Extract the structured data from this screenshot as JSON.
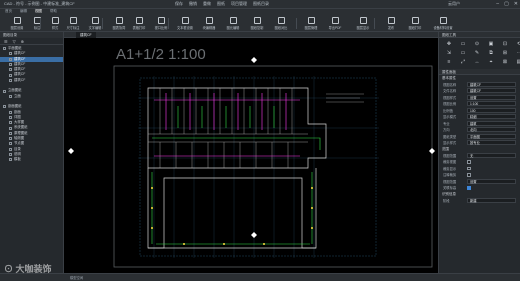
{
  "titlebar": {
    "title": "CAD - 符号 - 示例图 - 中建标准_建筑CF"
  },
  "quick_actions": [
    "保存",
    "撤销",
    "重做",
    "图纸",
    "项目管理",
    "图纸目录"
  ],
  "user": {
    "name": "云用户"
  },
  "menu_tabs": [
    "首页",
    "编辑",
    "视图",
    "帮助"
  ],
  "ribbon_buttons": [
    "图层设置",
    "标注",
    "样式",
    "尺寸标注",
    "文字编辑",
    "图表协同",
    "表格打印",
    "视口比例",
    "文本框设置",
    "块编辑器",
    "图元编辑",
    "图纸复制",
    "图纸对比",
    "图层管理",
    "导出PDF",
    "图层显示",
    "发布",
    "图纸打印",
    "设备材料设置"
  ],
  "left_panel": {
    "header": "图纸目录",
    "tools": [
      "☰",
      "▽",
      "⊕"
    ],
    "items": [
      {
        "label": "平面图纸",
        "indent": 0,
        "selected": false
      },
      {
        "label": "建筑CF",
        "indent": 1,
        "selected": false
      },
      {
        "label": "建筑CF",
        "indent": 1,
        "selected": true
      },
      {
        "label": "建筑CF",
        "indent": 1,
        "selected": false
      },
      {
        "label": "建筑CF",
        "indent": 1,
        "selected": false
      },
      {
        "label": "建筑CF",
        "indent": 1,
        "selected": false
      },
      {
        "label": "建筑CF",
        "indent": 1,
        "selected": false
      },
      {
        "label": "",
        "indent": 0,
        "selected": false
      },
      {
        "label": "立面图纸",
        "indent": 0,
        "selected": false
      },
      {
        "label": "立面",
        "indent": 1,
        "selected": false
      },
      {
        "label": "",
        "indent": 0,
        "selected": false
      },
      {
        "label": "剖面图纸",
        "indent": 0,
        "selected": false
      },
      {
        "label": "剖面",
        "indent": 1,
        "selected": false
      },
      {
        "label": "详图",
        "indent": 1,
        "selected": false
      },
      {
        "label": "大样图",
        "indent": 1,
        "selected": false
      },
      {
        "label": "系统图纸",
        "indent": 1,
        "selected": false
      },
      {
        "label": "原理图纸",
        "indent": 1,
        "selected": false
      },
      {
        "label": "轴测图",
        "indent": 1,
        "selected": false
      },
      {
        "label": "节点图",
        "indent": 1,
        "selected": false
      },
      {
        "label": "目录",
        "indent": 1,
        "selected": false
      },
      {
        "label": "说明",
        "indent": 1,
        "selected": false
      },
      {
        "label": "模板",
        "indent": 1,
        "selected": false
      }
    ]
  },
  "doc_tab": {
    "label": "建筑CF"
  },
  "canvas": {
    "sheet_title": "A1+1/2 1:100"
  },
  "right_panel": {
    "section1": "图纸工具",
    "tools": [
      "✥",
      "▭",
      "⊙",
      "▣",
      "⊡",
      "⟲",
      "⇲",
      "▭",
      "✎",
      "⧉",
      "⊞",
      "⋯",
      "≡",
      "⤢",
      "↔",
      "⌖",
      "⊠",
      "▤"
    ],
    "section2": "属性面板",
    "section3": "基本属性",
    "props": [
      {
        "k": "视图名称",
        "v": "建筑CF"
      },
      {
        "k": "文件名称",
        "v": "建筑CF"
      },
      {
        "k": "视图样式",
        "v": "设置"
      },
      {
        "k": "视图比例",
        "v": "1:100"
      },
      {
        "k": "比例值",
        "v": "100"
      },
      {
        "k": "显示模式",
        "v": "精细"
      },
      {
        "k": "专业",
        "v": "建筑"
      },
      {
        "k": "方向",
        "v": "北向"
      },
      {
        "k": "图纸类型",
        "v": "平面图"
      },
      {
        "k": "显示样式",
        "v": "按专业"
      }
    ],
    "section4": "范围",
    "checks": [
      {
        "k": "视图范围",
        "v": "无",
        "type": "text"
      },
      {
        "k": "裁剪视图",
        "on": false
      },
      {
        "k": "裁剪显示",
        "on": false
      },
      {
        "k": "注释裁剪",
        "on": false
      },
      {
        "k": "视图范围",
        "v": "设置",
        "type": "text"
      },
      {
        "k": "关联标高",
        "on": true
      }
    ],
    "section5": "识别信息",
    "last": {
      "k": "阶段",
      "v": "新建"
    }
  },
  "status": {
    "text": "模型空间"
  },
  "watermark": "⊙ 大咖装饰"
}
